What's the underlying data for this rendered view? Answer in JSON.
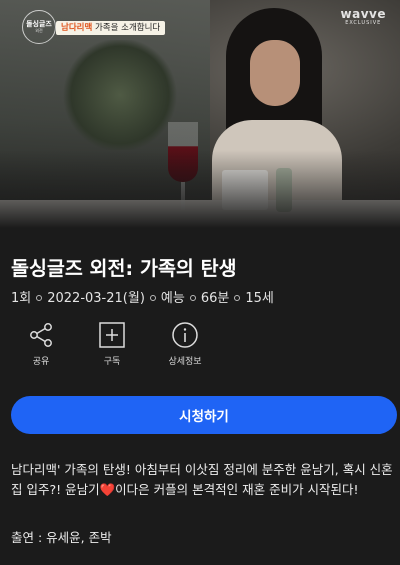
{
  "hero": {
    "show_logo": {
      "main": "돌싱글즈",
      "sub": "외전"
    },
    "caption": {
      "highlight": "남다리맥",
      "rest": "가족을 소개합니다"
    },
    "brand": {
      "name": "wavve",
      "tag": "EXCLUSIVE"
    }
  },
  "program": {
    "title": "돌싱글즈 외전: 가족의 탄생",
    "meta": [
      "1회",
      "2022-03-21(월)",
      "예능",
      "66분",
      "15세"
    ]
  },
  "actions": [
    {
      "label": "공유",
      "icon": "share-icon"
    },
    {
      "label": "구독",
      "icon": "plus-box-icon"
    },
    {
      "label": "상세정보",
      "icon": "info-icon"
    }
  ],
  "watch_button": {
    "label": "시청하기",
    "color": "#1f64f5"
  },
  "description": {
    "part1": "남다리맥' 가족의 탄생! 아침부터 이삿짐 정리에 분주한 윤남기, 혹시 신혼집 입주?! 윤남기",
    "heart": "❤️",
    "part2": "이다은 커플의 본격적인 재혼 준비가 시작된다!"
  },
  "cast": "출연 : 유세윤, 존박"
}
